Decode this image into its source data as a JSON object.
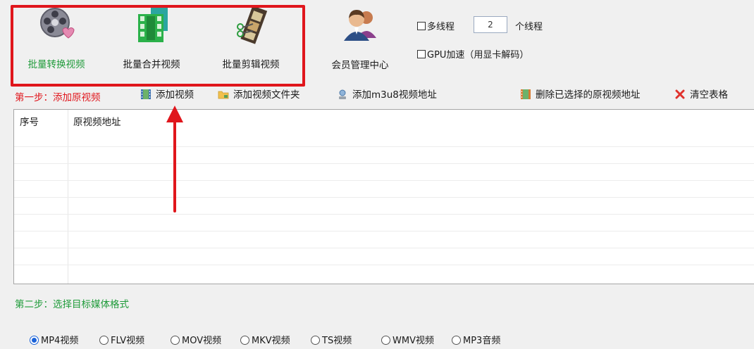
{
  "toolbar": {
    "tools": [
      {
        "label": "批量转换视频",
        "icon": "film-reel-heart-icon",
        "active": true
      },
      {
        "label": "批量合并视频",
        "icon": "green-film-strip-icon",
        "active": false
      },
      {
        "label": "批量剪辑视频",
        "icon": "film-scissors-icon",
        "active": false
      },
      {
        "label": "会员管理中心",
        "icon": "members-icon",
        "active": false
      }
    ],
    "multithread_label": "多线程",
    "thread_count": "2",
    "thread_unit": "个线程",
    "gpu_label": "GPU加速（用显卡解码）"
  },
  "step1": {
    "title": "第一步：添加原视频",
    "actions": [
      {
        "label": "添加视频",
        "icon": "add-video-icon"
      },
      {
        "label": "添加视频文件夹",
        "icon": "folder-icon"
      },
      {
        "label": "添加m3u8视频地址",
        "icon": "link-icon"
      },
      {
        "label": "删除已选择的原视频地址",
        "icon": "delete-video-icon"
      },
      {
        "label": "清空表格",
        "icon": "clear-x-icon"
      }
    ]
  },
  "table": {
    "columns": [
      "序号",
      "原视频地址"
    ],
    "rows": []
  },
  "step2": {
    "title": "第二步：选择目标媒体格式",
    "formats": [
      {
        "label": "MP4视频",
        "selected": true
      },
      {
        "label": "FLV视频",
        "selected": false
      },
      {
        "label": "MOV视频",
        "selected": false
      },
      {
        "label": "MKV视频",
        "selected": false
      },
      {
        "label": "TS视频",
        "selected": false
      },
      {
        "label": "WMV视频",
        "selected": false
      },
      {
        "label": "MP3音频",
        "selected": false
      }
    ]
  },
  "colors": {
    "accent_green": "#1f9b3a",
    "step_red": "#e0161c",
    "highlight_red": "#e0161c",
    "radio_blue": "#1a62d8"
  }
}
